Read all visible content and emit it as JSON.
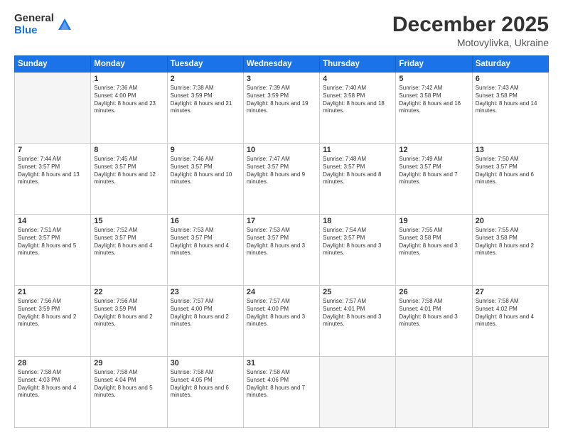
{
  "logo": {
    "general": "General",
    "blue": "Blue"
  },
  "title": {
    "month": "December 2025",
    "location": "Motovylivka, Ukraine"
  },
  "weekdays": [
    "Sunday",
    "Monday",
    "Tuesday",
    "Wednesday",
    "Thursday",
    "Friday",
    "Saturday"
  ],
  "weeks": [
    [
      {
        "day": "",
        "sunrise": "",
        "sunset": "",
        "daylight": ""
      },
      {
        "day": "1",
        "sunrise": "Sunrise: 7:36 AM",
        "sunset": "Sunset: 4:00 PM",
        "daylight": "Daylight: 8 hours and 23 minutes."
      },
      {
        "day": "2",
        "sunrise": "Sunrise: 7:38 AM",
        "sunset": "Sunset: 3:59 PM",
        "daylight": "Daylight: 8 hours and 21 minutes."
      },
      {
        "day": "3",
        "sunrise": "Sunrise: 7:39 AM",
        "sunset": "Sunset: 3:59 PM",
        "daylight": "Daylight: 8 hours and 19 minutes."
      },
      {
        "day": "4",
        "sunrise": "Sunrise: 7:40 AM",
        "sunset": "Sunset: 3:58 PM",
        "daylight": "Daylight: 8 hours and 18 minutes."
      },
      {
        "day": "5",
        "sunrise": "Sunrise: 7:42 AM",
        "sunset": "Sunset: 3:58 PM",
        "daylight": "Daylight: 8 hours and 16 minutes."
      },
      {
        "day": "6",
        "sunrise": "Sunrise: 7:43 AM",
        "sunset": "Sunset: 3:58 PM",
        "daylight": "Daylight: 8 hours and 14 minutes."
      }
    ],
    [
      {
        "day": "7",
        "sunrise": "Sunrise: 7:44 AM",
        "sunset": "Sunset: 3:57 PM",
        "daylight": "Daylight: 8 hours and 13 minutes."
      },
      {
        "day": "8",
        "sunrise": "Sunrise: 7:45 AM",
        "sunset": "Sunset: 3:57 PM",
        "daylight": "Daylight: 8 hours and 12 minutes."
      },
      {
        "day": "9",
        "sunrise": "Sunrise: 7:46 AM",
        "sunset": "Sunset: 3:57 PM",
        "daylight": "Daylight: 8 hours and 10 minutes."
      },
      {
        "day": "10",
        "sunrise": "Sunrise: 7:47 AM",
        "sunset": "Sunset: 3:57 PM",
        "daylight": "Daylight: 8 hours and 9 minutes."
      },
      {
        "day": "11",
        "sunrise": "Sunrise: 7:48 AM",
        "sunset": "Sunset: 3:57 PM",
        "daylight": "Daylight: 8 hours and 8 minutes."
      },
      {
        "day": "12",
        "sunrise": "Sunrise: 7:49 AM",
        "sunset": "Sunset: 3:57 PM",
        "daylight": "Daylight: 8 hours and 7 minutes."
      },
      {
        "day": "13",
        "sunrise": "Sunrise: 7:50 AM",
        "sunset": "Sunset: 3:57 PM",
        "daylight": "Daylight: 8 hours and 6 minutes."
      }
    ],
    [
      {
        "day": "14",
        "sunrise": "Sunrise: 7:51 AM",
        "sunset": "Sunset: 3:57 PM",
        "daylight": "Daylight: 8 hours and 5 minutes."
      },
      {
        "day": "15",
        "sunrise": "Sunrise: 7:52 AM",
        "sunset": "Sunset: 3:57 PM",
        "daylight": "Daylight: 8 hours and 4 minutes."
      },
      {
        "day": "16",
        "sunrise": "Sunrise: 7:53 AM",
        "sunset": "Sunset: 3:57 PM",
        "daylight": "Daylight: 8 hours and 4 minutes."
      },
      {
        "day": "17",
        "sunrise": "Sunrise: 7:53 AM",
        "sunset": "Sunset: 3:57 PM",
        "daylight": "Daylight: 8 hours and 3 minutes."
      },
      {
        "day": "18",
        "sunrise": "Sunrise: 7:54 AM",
        "sunset": "Sunset: 3:57 PM",
        "daylight": "Daylight: 8 hours and 3 minutes."
      },
      {
        "day": "19",
        "sunrise": "Sunrise: 7:55 AM",
        "sunset": "Sunset: 3:58 PM",
        "daylight": "Daylight: 8 hours and 3 minutes."
      },
      {
        "day": "20",
        "sunrise": "Sunrise: 7:55 AM",
        "sunset": "Sunset: 3:58 PM",
        "daylight": "Daylight: 8 hours and 2 minutes."
      }
    ],
    [
      {
        "day": "21",
        "sunrise": "Sunrise: 7:56 AM",
        "sunset": "Sunset: 3:59 PM",
        "daylight": "Daylight: 8 hours and 2 minutes."
      },
      {
        "day": "22",
        "sunrise": "Sunrise: 7:56 AM",
        "sunset": "Sunset: 3:59 PM",
        "daylight": "Daylight: 8 hours and 2 minutes."
      },
      {
        "day": "23",
        "sunrise": "Sunrise: 7:57 AM",
        "sunset": "Sunset: 4:00 PM",
        "daylight": "Daylight: 8 hours and 2 minutes."
      },
      {
        "day": "24",
        "sunrise": "Sunrise: 7:57 AM",
        "sunset": "Sunset: 4:00 PM",
        "daylight": "Daylight: 8 hours and 3 minutes."
      },
      {
        "day": "25",
        "sunrise": "Sunrise: 7:57 AM",
        "sunset": "Sunset: 4:01 PM",
        "daylight": "Daylight: 8 hours and 3 minutes."
      },
      {
        "day": "26",
        "sunrise": "Sunrise: 7:58 AM",
        "sunset": "Sunset: 4:01 PM",
        "daylight": "Daylight: 8 hours and 3 minutes."
      },
      {
        "day": "27",
        "sunrise": "Sunrise: 7:58 AM",
        "sunset": "Sunset: 4:02 PM",
        "daylight": "Daylight: 8 hours and 4 minutes."
      }
    ],
    [
      {
        "day": "28",
        "sunrise": "Sunrise: 7:58 AM",
        "sunset": "Sunset: 4:03 PM",
        "daylight": "Daylight: 8 hours and 4 minutes."
      },
      {
        "day": "29",
        "sunrise": "Sunrise: 7:58 AM",
        "sunset": "Sunset: 4:04 PM",
        "daylight": "Daylight: 8 hours and 5 minutes."
      },
      {
        "day": "30",
        "sunrise": "Sunrise: 7:58 AM",
        "sunset": "Sunset: 4:05 PM",
        "daylight": "Daylight: 8 hours and 6 minutes."
      },
      {
        "day": "31",
        "sunrise": "Sunrise: 7:58 AM",
        "sunset": "Sunset: 4:06 PM",
        "daylight": "Daylight: 8 hours and 7 minutes."
      },
      {
        "day": "",
        "sunrise": "",
        "sunset": "",
        "daylight": ""
      },
      {
        "day": "",
        "sunrise": "",
        "sunset": "",
        "daylight": ""
      },
      {
        "day": "",
        "sunrise": "",
        "sunset": "",
        "daylight": ""
      }
    ]
  ]
}
